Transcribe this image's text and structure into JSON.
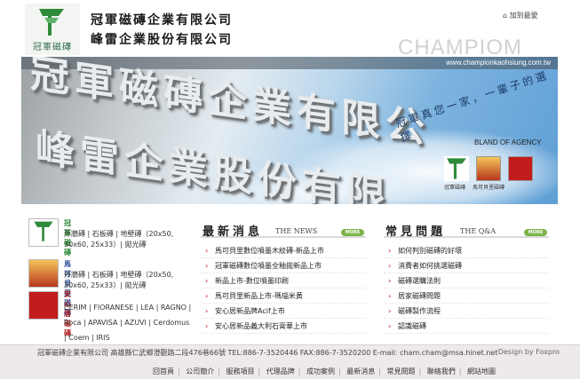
{
  "header": {
    "logo_caption": "冠軍磁磚",
    "company_line1": "冠軍磁磚企業有限公司",
    "company_line2": "峰雷企業股份有限公司",
    "favorite_label": "加到最愛",
    "watermark": "CHAMPIOM"
  },
  "banner": {
    "url": "www.championkaohsiung.com.tw",
    "headline1": "冠軍磁磚企業有限公",
    "headline2": "峰雷企業股份有限",
    "slogan": "冠軍真您一家，一輩子的選擇",
    "agency_label": "BLAND OF AGENCY",
    "brand_captions": [
      "冠軍磁磚",
      "馬可貝里磁磚",
      ""
    ]
  },
  "sidebar": {
    "brands": [
      {
        "title": "冠軍磁磚",
        "desc": "外牆磚 | 石板磚 | 地壁磚（20x50, 30x60, 25x33）| 拋光磚",
        "color": "#2f8a3a"
      },
      {
        "title": "馬可貝里磁磚",
        "desc": "外牆磚 | 石板磚 | 地壁磚（20x50, 30x60, 25x33）| 拋光磚",
        "color": "#2a4f9a"
      },
      {
        "title": "安心居磁磚",
        "desc": "CERIM | FIORANESE | LEA | RAGNO | Roca | APAVISA | AZUVI | Cerdomus | Coem | IRIS",
        "color": "#b11c1c"
      }
    ]
  },
  "news": {
    "title_zh": "最新消息",
    "title_en": "THE NEWS",
    "more": "MORE",
    "items": [
      "馬可貝里數位噴墨木紋磚-新品上市",
      "冠軍磁磚數位噴墨全釉拋新品上市",
      "新品上市-數位噴墨印刷",
      "馬可貝里新品上市-瑪瑙米黃",
      "安心居新品牌Acif上市",
      "安心居新品義大利石膏華上市"
    ]
  },
  "qa": {
    "title_zh": "常見問題",
    "title_en": "THE Q&A",
    "more": "MORE",
    "items": [
      "如何判別磁磚的好壞",
      "消費者如何挑選磁磚",
      "磁磚選購法則",
      "居家磁磚問題",
      "磁磚製作流程",
      "認識磁磚"
    ]
  },
  "footer": {
    "line1": "冠軍磁磚企業有限公司 高雄縣仁武鄉澄觀路二段476巷66號 TEL:886-7-3520446 FAX:886-7-3520200 E-mail: cham.cham@msa.hinet.net",
    "design": "Design by Foxpro",
    "links": [
      "回首頁",
      "公司簡介",
      "服務項目",
      "代理品牌",
      "成功案例",
      "最新消息",
      "常見問題",
      "聯絡我們",
      "網站地圖"
    ]
  }
}
